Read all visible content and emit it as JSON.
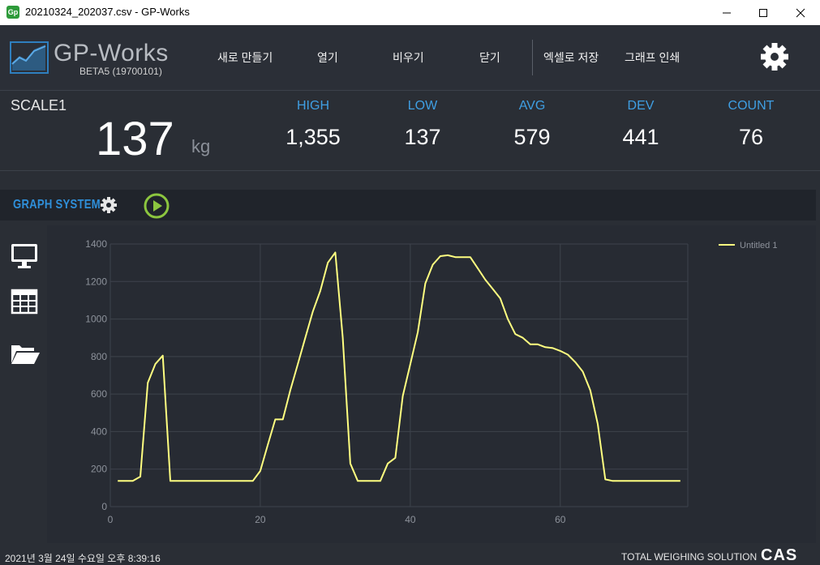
{
  "window": {
    "title": "20210324_202037.csv - GP-Works",
    "app_badge": "Gp",
    "minimize_label": "—",
    "maximize_label": "☐",
    "close_label": "✕"
  },
  "header": {
    "logo_text": "GP-Works",
    "version": "BETA5 (19700101)",
    "menu": [
      {
        "label": "새로 만들기"
      },
      {
        "label": "열기"
      },
      {
        "label": "비우기"
      },
      {
        "label": "닫기"
      },
      {
        "label": "엑셀로 저장"
      },
      {
        "label": "그래프 인쇄"
      }
    ],
    "settings_icon": "gear-icon"
  },
  "scale": {
    "label": "SCALE1",
    "value": "137",
    "unit": "kg"
  },
  "stats": [
    {
      "label": "HIGH",
      "value": "1,355"
    },
    {
      "label": "LOW",
      "value": "137"
    },
    {
      "label": "AVG",
      "value": "579"
    },
    {
      "label": "DEV",
      "value": "441"
    },
    {
      "label": "COUNT",
      "value": "76"
    }
  ],
  "graph_system": {
    "title": "GRAPH SYSTEM",
    "settings_icon": "gear-icon",
    "play_icon": "play-icon"
  },
  "sidebar": [
    {
      "icon": "monitor-icon"
    },
    {
      "icon": "table-icon"
    },
    {
      "icon": "folder-open-icon"
    }
  ],
  "status": {
    "datetime": "2021년 3월 24일 수요일 오후 8:39:16",
    "brand": "TOTAL WEIGHING SOLUTION",
    "logo": "CAS"
  },
  "colors": {
    "background": "#2a2e35",
    "accent_blue": "#3f9fe3",
    "series_line": "#ffff80",
    "play_green": "#8cc63f"
  },
  "chart_data": {
    "type": "line",
    "title": "",
    "xlabel": "",
    "ylabel": "",
    "xlim": [
      0,
      77
    ],
    "ylim": [
      0,
      1400
    ],
    "x_ticks": [
      0,
      20,
      40,
      60
    ],
    "y_ticks": [
      0,
      200,
      400,
      600,
      800,
      1000,
      1200,
      1400
    ],
    "grid": true,
    "legend": "top-right",
    "series": [
      {
        "name": "Untitled 1",
        "color": "#ffff80",
        "x": [
          1,
          2,
          3,
          4,
          5,
          6,
          7,
          8,
          9,
          10,
          11,
          12,
          13,
          14,
          15,
          16,
          17,
          18,
          19,
          20,
          21,
          22,
          23,
          24,
          25,
          26,
          27,
          28,
          29,
          30,
          31,
          32,
          33,
          34,
          35,
          36,
          37,
          38,
          39,
          40,
          41,
          42,
          43,
          44,
          45,
          46,
          47,
          48,
          49,
          50,
          51,
          52,
          53,
          54,
          55,
          56,
          57,
          58,
          59,
          60,
          61,
          62,
          63,
          64,
          65,
          66,
          67,
          68,
          69,
          70,
          71,
          72,
          73,
          74,
          75,
          76
        ],
        "values": [
          137,
          137,
          137,
          160,
          660,
          760,
          805,
          137,
          137,
          137,
          137,
          137,
          137,
          137,
          137,
          137,
          137,
          137,
          137,
          190,
          330,
          465,
          465,
          620,
          760,
          900,
          1040,
          1150,
          1300,
          1355,
          900,
          230,
          137,
          137,
          137,
          137,
          230,
          260,
          590,
          760,
          930,
          1190,
          1290,
          1335,
          1340,
          1330,
          1330,
          1330,
          1270,
          1210,
          1160,
          1110,
          1000,
          920,
          900,
          865,
          865,
          850,
          845,
          830,
          810,
          770,
          720,
          620,
          440,
          145,
          137,
          137,
          137,
          137,
          137,
          137,
          137,
          137,
          137,
          137
        ]
      }
    ]
  }
}
